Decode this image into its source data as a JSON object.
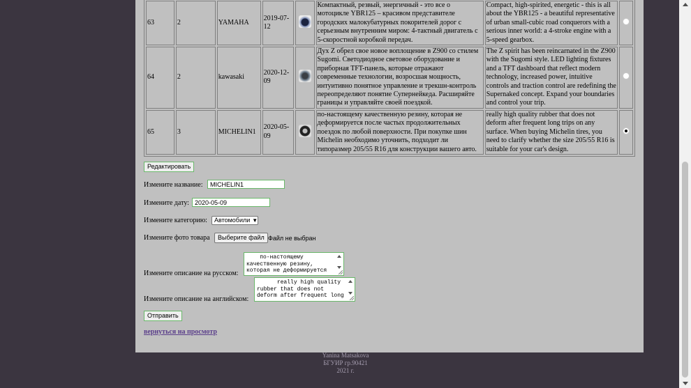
{
  "products": [
    {
      "id": "63",
      "category": "2",
      "name": "YAMAHA",
      "date": "2019-07-12",
      "image_icon": "motorcycle-photo",
      "description_ru": "Компактный, резвый, энергичный - это все о мотоцикле YBR125 – красивом представителе городских малокубатурных покорителей дорог с серьезным внутренним миром: 4-тактный двигатель с 5-скоростной коробкой передач.",
      "description_en": "Compact, high-spirited, energetic - this is all about the YBR125 - a beautiful representative of urban small-cubic road conquerors with a serious inner world: a 4-stroke engine with a 5-speed gearbox.",
      "selected": false
    },
    {
      "id": "64",
      "category": "2",
      "name": "kawasaki",
      "date": "2020-12-09",
      "image_icon": "motorcycle-photo",
      "description_ru": "Дух Z обрел свое новое воплощение в Z900 со стилем Sugomi. Светодиодное световое оборудование и приборная TFT-панель, которые отражают современные технологии, возросшая мощность, интуитивно понятное управление и трекшн-контроль переопределяют понятие Супернейкеда. Расширяйте границы и управляйте своей поездкой.",
      "description_en": "The Z spirit has been reincarnated in the Z900 with the Sugomi style. LED lighting fixtures and a TFT dashboard that reflect modern technology, increased power, intuitive controls and traction control are redefining the Supernaked concept. Expand your boundaries and control your trip.",
      "selected": false
    },
    {
      "id": "65",
      "category": "3",
      "name": "MICHELIN1",
      "date": "2020-05-09",
      "image_icon": "tire-photo",
      "description_ru": "по-настоящему качественную резину, которая не деформируется после частых продолжительных поездок по любой поверхности. При покупке шин Michelin необходимо уточнить, подходит ли типоразмер 205/55 R16 для конструкции вашего авто.",
      "description_en": "really high quality rubber that does not deform after frequent long trips on any surface. When buying Michelin tires, you need to clarify whether the size 205/55 R16 is suitable for your car's design.",
      "selected": true
    }
  ],
  "edit_button_label": "Редактировать",
  "form": {
    "name_label": "Измените название:",
    "name_value": "MICHELIN1",
    "date_label": "Измените дату:",
    "date_value": "2020-05-09",
    "category_label": "Измените категорию:",
    "category_value": "Автомобили",
    "photo_label": "Измените фото товара",
    "file_button": "Выберите файл",
    "file_status": "Файл не выбран",
    "desc_ru_label": "Измените описание на русском:",
    "desc_ru_value": "    по-настоящему\nкачественную резину,\nкоторая не деформируется",
    "desc_en_label": "Измените описание на английском:",
    "desc_en_value": "      really high quality\nrubber that does not\ndeform after frequent long",
    "submit_label": "Отправить"
  },
  "back_link": "вернуться на просмотр",
  "footer": {
    "line1": "Yanina Matsakova",
    "line2": "БГУИР гр.90421",
    "line3": "2021 г."
  },
  "colors": {
    "page_bg": "#c0c0c0",
    "outer_bg": "#3b3540",
    "input_border": "#6ab86a",
    "link": "#5a3e8a"
  }
}
